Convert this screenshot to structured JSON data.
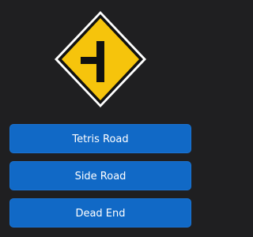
{
  "question": {
    "sign_icon": "side-road-right-warning-sign-icon",
    "sign_colors": {
      "fill": "#f6c40c",
      "border": "#111111",
      "outline": "#ffffff",
      "symbol": "#111111"
    }
  },
  "answers": [
    {
      "label": "Tetris Road"
    },
    {
      "label": "Side Road"
    },
    {
      "label": "Dead End"
    }
  ],
  "colors": {
    "background": "#1f1f21",
    "button": "#1169c6",
    "button_text": "#ffffff"
  }
}
